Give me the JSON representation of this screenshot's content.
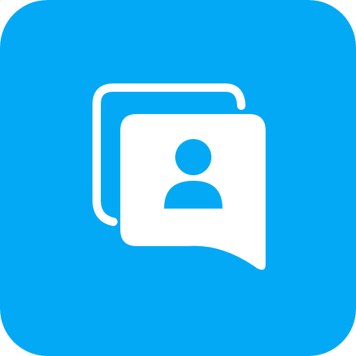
{
  "icon": {
    "name": "contacts-chat-app-icon",
    "glyph": "user-chat-bubbles-icon",
    "colors": {
      "background": "#03A9F4",
      "foreground": "#FFFFFF"
    }
  }
}
